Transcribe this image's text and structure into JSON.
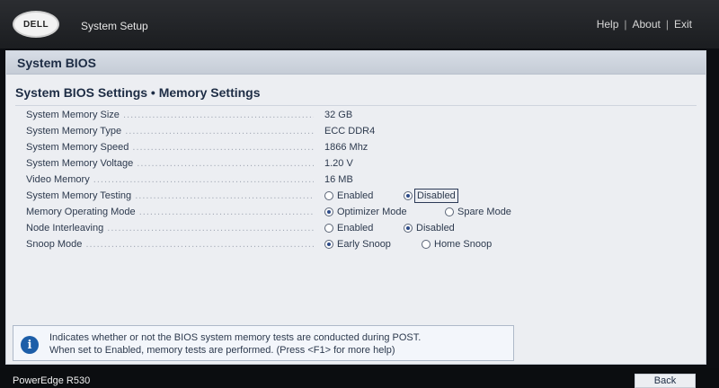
{
  "app": {
    "logo_text": "DELL",
    "title": "System Setup",
    "links": {
      "help": "Help",
      "about": "About",
      "exit": "Exit"
    }
  },
  "section": {
    "title": "System BIOS"
  },
  "page": {
    "title": "System BIOS Settings • Memory Settings"
  },
  "settings": [
    {
      "label": "System Memory Size",
      "value": "32 GB"
    },
    {
      "label": "System Memory Type",
      "value": "ECC DDR4"
    },
    {
      "label": "System Memory Speed",
      "value": "1866 Mhz"
    },
    {
      "label": "System Memory Voltage",
      "value": "1.20 V"
    },
    {
      "label": "Video Memory",
      "value": "16 MB"
    },
    {
      "label": "System Memory Testing",
      "options": [
        "Enabled",
        "Disabled"
      ],
      "selected": "Disabled"
    },
    {
      "label": "Memory Operating Mode",
      "options": [
        "Optimizer Mode",
        "Spare Mode"
      ],
      "selected": "Optimizer Mode"
    },
    {
      "label": "Node Interleaving",
      "options": [
        "Enabled",
        "Disabled"
      ],
      "selected": "Disabled"
    },
    {
      "label": "Snoop Mode",
      "options": [
        "Early Snoop",
        "Home Snoop"
      ],
      "selected": "Early Snoop"
    }
  ],
  "help": {
    "icon": "info-icon",
    "line1": "Indicates whether or not the BIOS system memory tests are conducted during POST.",
    "line2": "When set to Enabled, memory tests are performed. (Press <F1> for more help)"
  },
  "footer": {
    "model": "PowerEdge R530",
    "back_label": "Back"
  },
  "colors": {
    "accent": "#1d5ea8",
    "header_bg": "#1b1d20",
    "panel_bg": "#eceef2",
    "text": "#2d3a4e"
  }
}
